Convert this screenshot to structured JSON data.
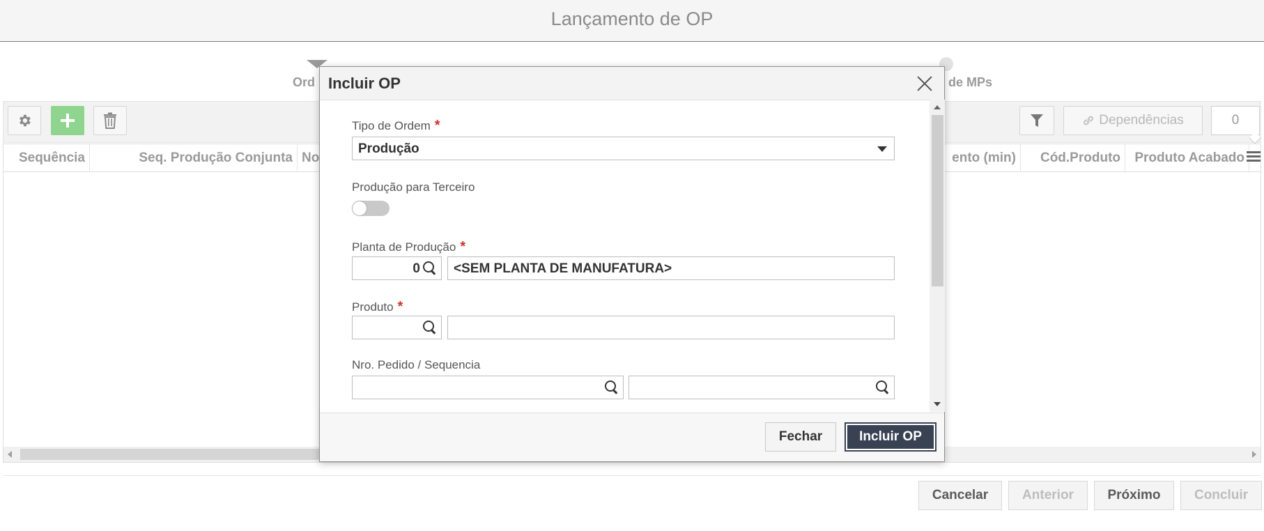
{
  "page": {
    "title": "Lançamento de OP",
    "steps": [
      "Ord",
      "de MPs"
    ]
  },
  "toolbar": {
    "dependencias_label": "Dependências",
    "count": "0",
    "icons": [
      "gear-icon",
      "plus-icon",
      "trash-icon",
      "filter-icon",
      "link-icon"
    ]
  },
  "grid": {
    "columns": [
      "Sequência",
      "Seq. Produção Conjunta",
      "No",
      "ento (min)",
      "Cód.Produto",
      "Produto Acabado"
    ]
  },
  "footer": {
    "cancel_label": "Cancelar",
    "previous_label": "Anterior",
    "next_label": "Próximo",
    "finish_label": "Concluir"
  },
  "modal": {
    "title": "Incluir OP",
    "fields": {
      "tipo_ordem": {
        "label": "Tipo de Ordem",
        "required_mark": "*",
        "value": "Produção"
      },
      "producao_terceiro": {
        "label": "Produção para Terceiro",
        "on": false
      },
      "planta": {
        "label": "Planta de Produção",
        "required_mark": "*",
        "code": "0",
        "description": "<SEM PLANTA DE MANUFATURA>"
      },
      "produto": {
        "label": "Produto",
        "required_mark": "*",
        "code": "",
        "description": ""
      },
      "pedido": {
        "label": "Nro. Pedido / Sequencia",
        "pedido": "",
        "sequencia": ""
      }
    },
    "close_label": "Fechar",
    "submit_label": "Incluir OP"
  },
  "colors": {
    "primary_button": "#384253",
    "add_button": "#8fd58f",
    "required": "#d0302a"
  }
}
